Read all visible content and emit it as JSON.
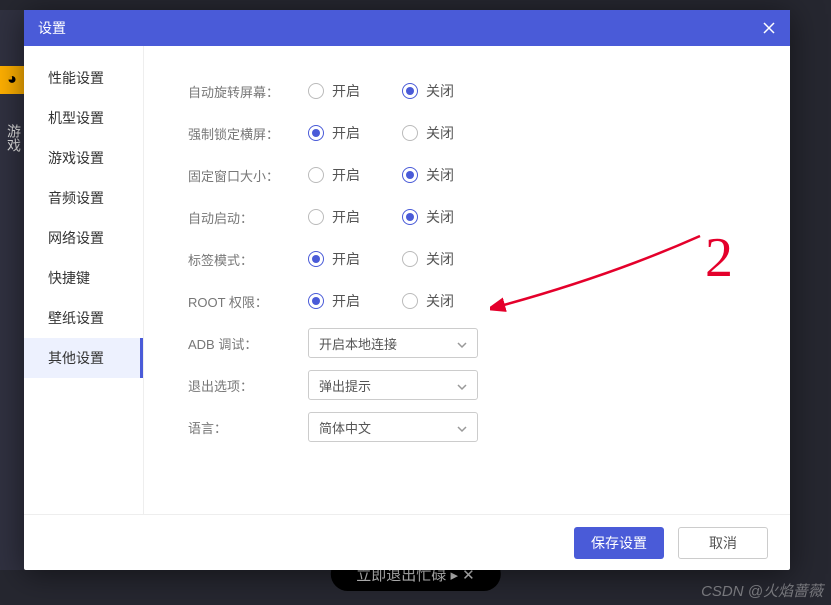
{
  "dialog_title": "设置",
  "sidebar": {
    "items": [
      {
        "label": "性能设置"
      },
      {
        "label": "机型设置"
      },
      {
        "label": "游戏设置"
      },
      {
        "label": "音频设置"
      },
      {
        "label": "网络设置"
      },
      {
        "label": "快捷键"
      },
      {
        "label": "壁纸设置"
      },
      {
        "label": "其他设置"
      }
    ],
    "active_index": 7
  },
  "options": {
    "on": "开启",
    "off": "关闭"
  },
  "rows": {
    "auto_rotate": {
      "label": "自动旋转屏幕：",
      "value": "off"
    },
    "force_landscape": {
      "label": "强制锁定横屏：",
      "value": "on"
    },
    "fixed_window": {
      "label": "固定窗口大小：",
      "value": "off"
    },
    "auto_start": {
      "label": "自动启动：",
      "value": "off"
    },
    "tab_mode": {
      "label": "标签模式：",
      "value": "on"
    },
    "root": {
      "label": "ROOT 权限：",
      "value": "on"
    },
    "adb": {
      "label": "ADB 调试：",
      "value": "开启本地连接"
    },
    "exit": {
      "label": "退出选项：",
      "value": "弹出提示"
    },
    "lang": {
      "label": "语言：",
      "value": "简体中文"
    }
  },
  "footer": {
    "save": "保存设置",
    "cancel": "取消"
  },
  "left_text": "游戏",
  "watermark": "CSDN @火焰蔷薇",
  "bg_pill": "立即退出忙碌 ▸ ✕",
  "annotation_number": "2"
}
